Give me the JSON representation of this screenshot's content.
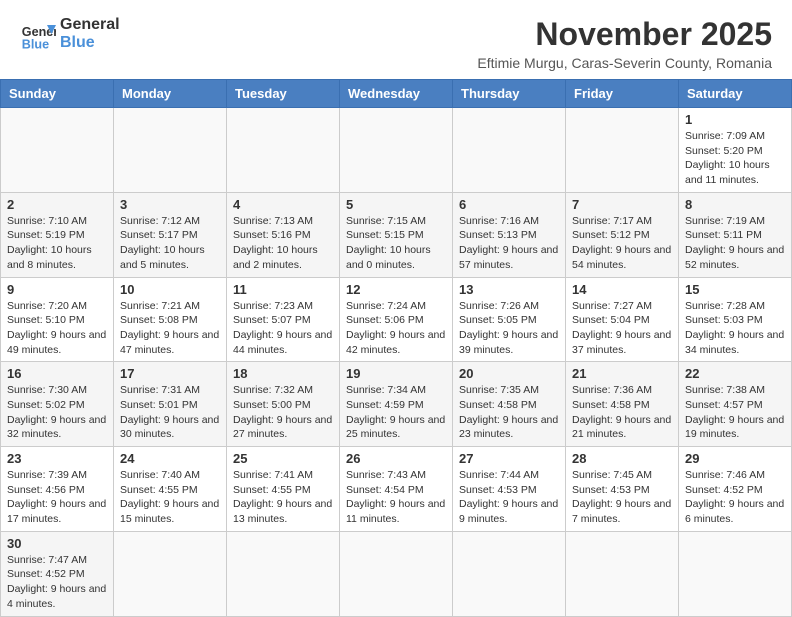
{
  "header": {
    "logo_general": "General",
    "logo_blue": "Blue",
    "month_title": "November 2025",
    "subtitle": "Eftimie Murgu, Caras-Severin County, Romania"
  },
  "days_of_week": [
    "Sunday",
    "Monday",
    "Tuesday",
    "Wednesday",
    "Thursday",
    "Friday",
    "Saturday"
  ],
  "weeks": [
    {
      "days": [
        {
          "num": "",
          "info": ""
        },
        {
          "num": "",
          "info": ""
        },
        {
          "num": "",
          "info": ""
        },
        {
          "num": "",
          "info": ""
        },
        {
          "num": "",
          "info": ""
        },
        {
          "num": "",
          "info": ""
        },
        {
          "num": "1",
          "info": "Sunrise: 7:09 AM\nSunset: 5:20 PM\nDaylight: 10 hours and 11 minutes."
        }
      ]
    },
    {
      "days": [
        {
          "num": "2",
          "info": "Sunrise: 7:10 AM\nSunset: 5:19 PM\nDaylight: 10 hours and 8 minutes."
        },
        {
          "num": "3",
          "info": "Sunrise: 7:12 AM\nSunset: 5:17 PM\nDaylight: 10 hours and 5 minutes."
        },
        {
          "num": "4",
          "info": "Sunrise: 7:13 AM\nSunset: 5:16 PM\nDaylight: 10 hours and 2 minutes."
        },
        {
          "num": "5",
          "info": "Sunrise: 7:15 AM\nSunset: 5:15 PM\nDaylight: 10 hours and 0 minutes."
        },
        {
          "num": "6",
          "info": "Sunrise: 7:16 AM\nSunset: 5:13 PM\nDaylight: 9 hours and 57 minutes."
        },
        {
          "num": "7",
          "info": "Sunrise: 7:17 AM\nSunset: 5:12 PM\nDaylight: 9 hours and 54 minutes."
        },
        {
          "num": "8",
          "info": "Sunrise: 7:19 AM\nSunset: 5:11 PM\nDaylight: 9 hours and 52 minutes."
        }
      ]
    },
    {
      "days": [
        {
          "num": "9",
          "info": "Sunrise: 7:20 AM\nSunset: 5:10 PM\nDaylight: 9 hours and 49 minutes."
        },
        {
          "num": "10",
          "info": "Sunrise: 7:21 AM\nSunset: 5:08 PM\nDaylight: 9 hours and 47 minutes."
        },
        {
          "num": "11",
          "info": "Sunrise: 7:23 AM\nSunset: 5:07 PM\nDaylight: 9 hours and 44 minutes."
        },
        {
          "num": "12",
          "info": "Sunrise: 7:24 AM\nSunset: 5:06 PM\nDaylight: 9 hours and 42 minutes."
        },
        {
          "num": "13",
          "info": "Sunrise: 7:26 AM\nSunset: 5:05 PM\nDaylight: 9 hours and 39 minutes."
        },
        {
          "num": "14",
          "info": "Sunrise: 7:27 AM\nSunset: 5:04 PM\nDaylight: 9 hours and 37 minutes."
        },
        {
          "num": "15",
          "info": "Sunrise: 7:28 AM\nSunset: 5:03 PM\nDaylight: 9 hours and 34 minutes."
        }
      ]
    },
    {
      "days": [
        {
          "num": "16",
          "info": "Sunrise: 7:30 AM\nSunset: 5:02 PM\nDaylight: 9 hours and 32 minutes."
        },
        {
          "num": "17",
          "info": "Sunrise: 7:31 AM\nSunset: 5:01 PM\nDaylight: 9 hours and 30 minutes."
        },
        {
          "num": "18",
          "info": "Sunrise: 7:32 AM\nSunset: 5:00 PM\nDaylight: 9 hours and 27 minutes."
        },
        {
          "num": "19",
          "info": "Sunrise: 7:34 AM\nSunset: 4:59 PM\nDaylight: 9 hours and 25 minutes."
        },
        {
          "num": "20",
          "info": "Sunrise: 7:35 AM\nSunset: 4:58 PM\nDaylight: 9 hours and 23 minutes."
        },
        {
          "num": "21",
          "info": "Sunrise: 7:36 AM\nSunset: 4:58 PM\nDaylight: 9 hours and 21 minutes."
        },
        {
          "num": "22",
          "info": "Sunrise: 7:38 AM\nSunset: 4:57 PM\nDaylight: 9 hours and 19 minutes."
        }
      ]
    },
    {
      "days": [
        {
          "num": "23",
          "info": "Sunrise: 7:39 AM\nSunset: 4:56 PM\nDaylight: 9 hours and 17 minutes."
        },
        {
          "num": "24",
          "info": "Sunrise: 7:40 AM\nSunset: 4:55 PM\nDaylight: 9 hours and 15 minutes."
        },
        {
          "num": "25",
          "info": "Sunrise: 7:41 AM\nSunset: 4:55 PM\nDaylight: 9 hours and 13 minutes."
        },
        {
          "num": "26",
          "info": "Sunrise: 7:43 AM\nSunset: 4:54 PM\nDaylight: 9 hours and 11 minutes."
        },
        {
          "num": "27",
          "info": "Sunrise: 7:44 AM\nSunset: 4:53 PM\nDaylight: 9 hours and 9 minutes."
        },
        {
          "num": "28",
          "info": "Sunrise: 7:45 AM\nSunset: 4:53 PM\nDaylight: 9 hours and 7 minutes."
        },
        {
          "num": "29",
          "info": "Sunrise: 7:46 AM\nSunset: 4:52 PM\nDaylight: 9 hours and 6 minutes."
        }
      ]
    },
    {
      "days": [
        {
          "num": "30",
          "info": "Sunrise: 7:47 AM\nSunset: 4:52 PM\nDaylight: 9 hours and 4 minutes."
        },
        {
          "num": "",
          "info": ""
        },
        {
          "num": "",
          "info": ""
        },
        {
          "num": "",
          "info": ""
        },
        {
          "num": "",
          "info": ""
        },
        {
          "num": "",
          "info": ""
        },
        {
          "num": "",
          "info": ""
        }
      ]
    }
  ]
}
